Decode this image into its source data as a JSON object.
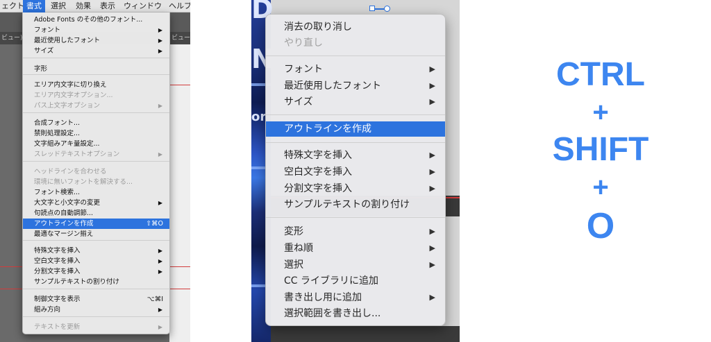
{
  "panel1": {
    "menubar": [
      "ェクト",
      "書式",
      "選択",
      "効果",
      "表示",
      "ウィンドウ",
      "ヘルプ"
    ],
    "doc_tabs": [
      "ビュー)",
      "ビュー)"
    ],
    "menu": {
      "title": "書式",
      "items": [
        {
          "label": "Adobe Fonts のその他のフォント...",
          "state": "enabled",
          "arrow": false
        },
        {
          "label": "フォント",
          "state": "enabled",
          "arrow": true
        },
        {
          "label": "最近使用したフォント",
          "state": "enabled",
          "arrow": true
        },
        {
          "label": "サイズ",
          "state": "enabled",
          "arrow": true
        },
        {
          "label": "字形",
          "state": "enabled",
          "arrow": false
        },
        {
          "label": "エリア内文字に切り換え",
          "state": "enabled",
          "arrow": false
        },
        {
          "label": "エリア内文字オプション...",
          "state": "disabled",
          "arrow": false
        },
        {
          "label": "パス上文字オプション",
          "state": "disabled",
          "arrow": true
        },
        {
          "label": "合成フォント...",
          "state": "enabled",
          "arrow": false
        },
        {
          "label": "禁則処理設定...",
          "state": "enabled",
          "arrow": false
        },
        {
          "label": "文字組みアキ量設定...",
          "state": "enabled",
          "arrow": false
        },
        {
          "label": "スレッドテキストオプション",
          "state": "disabled",
          "arrow": true
        },
        {
          "label": "ヘッドラインを合わせる",
          "state": "disabled",
          "arrow": false
        },
        {
          "label": "環境に無いフォントを解決する...",
          "state": "disabled",
          "arrow": false
        },
        {
          "label": "フォント検索...",
          "state": "enabled",
          "arrow": false
        },
        {
          "label": "大文字と小文字の変更",
          "state": "enabled",
          "arrow": true
        },
        {
          "label": "句読点の自動調節...",
          "state": "enabled",
          "arrow": false
        },
        {
          "label": "アウトラインを作成",
          "state": "highlighted",
          "arrow": false,
          "shortcut": "⇧⌘O"
        },
        {
          "label": "最適なマージン揃え",
          "state": "enabled",
          "arrow": false
        },
        {
          "label": "特殊文字を挿入",
          "state": "enabled",
          "arrow": true
        },
        {
          "label": "空白文字を挿入",
          "state": "enabled",
          "arrow": true
        },
        {
          "label": "分割文字を挿入",
          "state": "enabled",
          "arrow": true
        },
        {
          "label": "サンプルテキストの割り付け",
          "state": "enabled",
          "arrow": false
        },
        {
          "label": "制御文字を表示",
          "state": "enabled",
          "arrow": false,
          "shortcut": "⌥⌘I"
        },
        {
          "label": "組み方向",
          "state": "enabled",
          "arrow": true
        },
        {
          "label": "テキストを更新",
          "state": "disabled",
          "arrow": true
        }
      ]
    }
  },
  "panel2": {
    "art_letters": [
      "D",
      "N",
      "or"
    ],
    "menu": {
      "items": [
        {
          "label": "消去の取り消し",
          "state": "enabled",
          "arrow": false
        },
        {
          "label": "やり直し",
          "state": "disabled",
          "arrow": false
        },
        {
          "label": "フォント",
          "state": "enabled",
          "arrow": true
        },
        {
          "label": "最近使用したフォント",
          "state": "enabled",
          "arrow": true
        },
        {
          "label": "サイズ",
          "state": "enabled",
          "arrow": true
        },
        {
          "label": "アウトラインを作成",
          "state": "highlighted",
          "arrow": false
        },
        {
          "label": "特殊文字を挿入",
          "state": "enabled",
          "arrow": true
        },
        {
          "label": "空白文字を挿入",
          "state": "enabled",
          "arrow": true
        },
        {
          "label": "分割文字を挿入",
          "state": "enabled",
          "arrow": true
        },
        {
          "label": "サンプルテキストの割り付け",
          "state": "enabled",
          "arrow": false
        },
        {
          "label": "変形",
          "state": "enabled",
          "arrow": true
        },
        {
          "label": "重ね順",
          "state": "enabled",
          "arrow": true
        },
        {
          "label": "選択",
          "state": "enabled",
          "arrow": true
        },
        {
          "label": "CC ライブラリに追加",
          "state": "enabled",
          "arrow": false
        },
        {
          "label": "書き出し用に追加",
          "state": "enabled",
          "arrow": true
        },
        {
          "label": "選択範囲を書き出し...",
          "state": "enabled",
          "arrow": false
        }
      ]
    }
  },
  "panel3": {
    "lines": [
      "CTRL",
      "+",
      "SHIFT",
      "+",
      "O"
    ],
    "color": "#3d86f0"
  },
  "colors": {
    "highlight": "#2d73de",
    "accent_red": "#d23c3c"
  }
}
